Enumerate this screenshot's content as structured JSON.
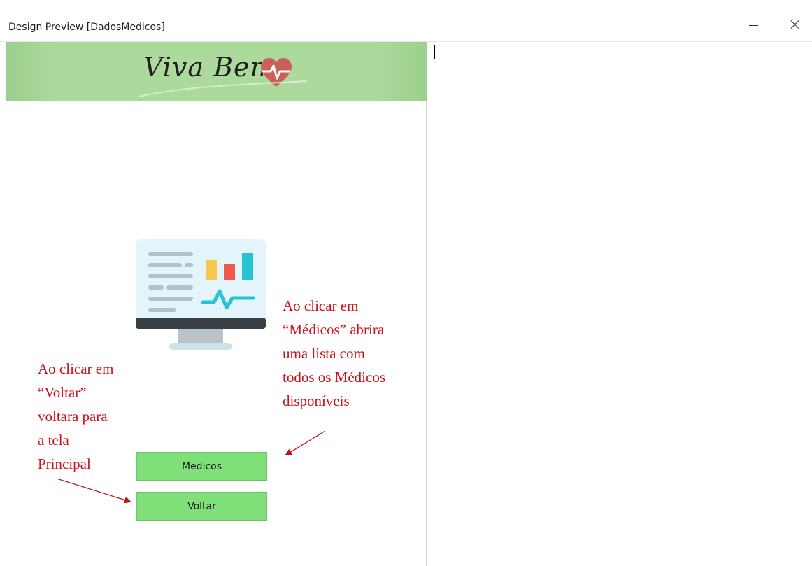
{
  "window": {
    "title": "Design Preview [DadosMedicos]"
  },
  "header": {
    "logo_text": "Viva Bem",
    "logo_icon": "heart-pulse-icon"
  },
  "illustration": {
    "icon": "monitor-dashboard-icon",
    "colors": {
      "screen": "#e4f4fb",
      "bezel": "#3a3f44",
      "bar_yellow": "#f7c94b",
      "bar_red": "#ef5a4a",
      "bar_teal": "#25c3d4",
      "pulse": "#25c3d4"
    }
  },
  "buttons": {
    "medicos": "Medicos",
    "voltar": "Voltar"
  },
  "annotations": {
    "left": [
      "Ao clicar em",
      "“Voltar”",
      "voltara para",
      "a tela",
      "Principal"
    ],
    "right": [
      "Ao clicar em",
      "“Médicos” abrira",
      "uma lista com",
      "todos os Médicos",
      "disponíveis"
    ]
  },
  "colors": {
    "header_green": "#acd99c",
    "button_green": "#7fe07a",
    "annotation_red": "#d0111a"
  }
}
